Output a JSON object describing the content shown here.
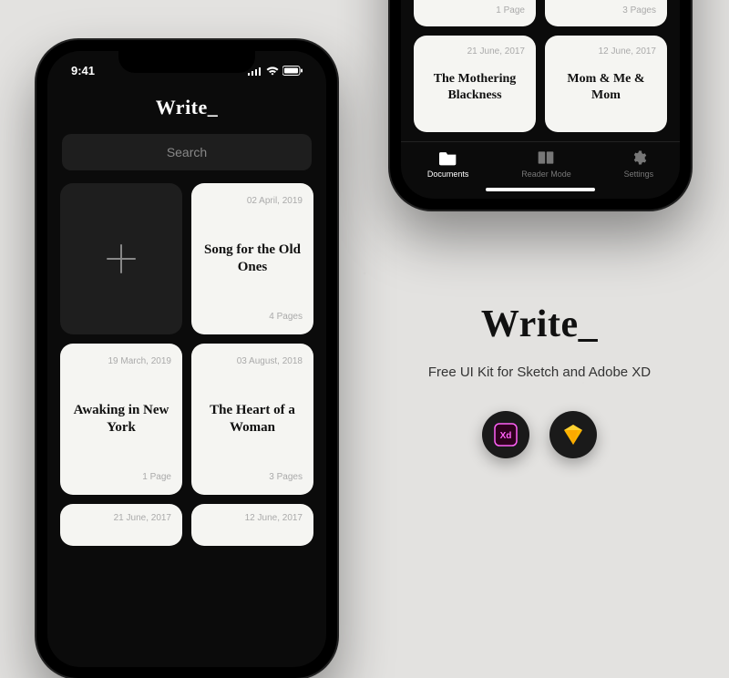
{
  "status": {
    "time": "9:41"
  },
  "app": {
    "title": "Write_"
  },
  "search": {
    "placeholder": "Search"
  },
  "cards": [
    {
      "date": "02 April, 2019",
      "title": "Song for the Old Ones",
      "pages": "4 Pages"
    },
    {
      "date": "19 March, 2019",
      "title": "Awaking in New York",
      "pages": "1 Page"
    },
    {
      "date": "03 August, 2018",
      "title": "The Heart of a Woman",
      "pages": "3 Pages"
    },
    {
      "date": "21 June, 2017",
      "title": "",
      "pages": ""
    },
    {
      "date": "12 June, 2017",
      "title": "",
      "pages": ""
    }
  ],
  "right": {
    "top_pages": [
      "1 Page",
      "3 Pages"
    ],
    "cards": [
      {
        "date": "21 June, 2017",
        "title": "The Mothering Blackness"
      },
      {
        "date": "12 June, 2017",
        "title": "Mom & Me & Mom"
      }
    ]
  },
  "tabs": {
    "documents": "Documents",
    "reader": "Reader Mode",
    "settings": "Settings"
  },
  "promo": {
    "title": "Write_",
    "subtitle": "Free UI Kit for Sketch and Adobe XD"
  }
}
